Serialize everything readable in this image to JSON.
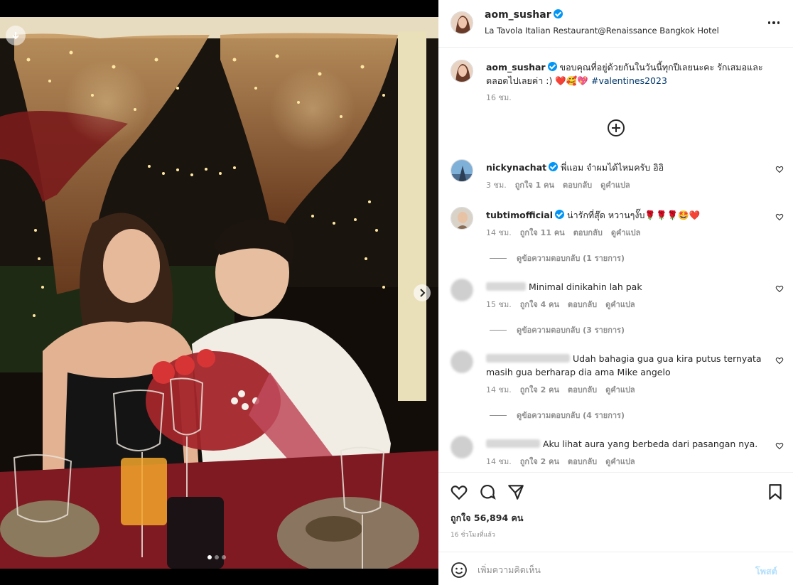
{
  "post": {
    "username": "aom_sushar",
    "location": "La Tavola Italian Restaurant@Renaissance Bangkok Hotel",
    "caption_text": "ขอบคุณที่อยู่ด้วยกันในวันนี้ทุกปีเลยนะคะ รักเสมอและตลอดไปเลยค่า :) ❤️🥰💖 ",
    "hashtag": "#valentines2023",
    "caption_time": "16 ชม.",
    "likes": "ถูกใจ 56,894 คน",
    "posted": "16 ชั่วโมงที่แล้ว",
    "media_dots": 3,
    "active_dot": 0
  },
  "comments": [
    {
      "username": "nickynachat",
      "verified": true,
      "text": "พี่แอม จำผมได้ไหมครับ อิอิ",
      "time": "3 ชม.",
      "likes": "ถูกใจ 1 คน",
      "reply": "ตอบกลับ",
      "translate": "ดูคำแปล",
      "replies": ""
    },
    {
      "username": "tubtimofficial",
      "verified": true,
      "text": "น่ารักที่สุ๊ด หวานๆงั๊บ🌹🌹🌹🤩❤️",
      "time": "14 ชม.",
      "likes": "ถูกใจ 11 คน",
      "reply": "ตอบกลับ",
      "translate": "ดูคำแปล",
      "replies": "ดูข้อความตอบกลับ (1 รายการ)"
    },
    {
      "username": "",
      "verified": false,
      "text": "Minimal dinikahin lah pak",
      "time": "15 ชม.",
      "likes": "ถูกใจ 4 คน",
      "reply": "ตอบกลับ",
      "translate": "ดูคำแปล",
      "replies": "ดูข้อความตอบกลับ (3 รายการ)"
    },
    {
      "username": "",
      "verified": false,
      "text": "Udah bahagia gua gua kira putus ternyata masih gua berharap dia ama Mike angelo",
      "time": "14 ชม.",
      "likes": "ถูกใจ 2 คน",
      "reply": "ตอบกลับ",
      "translate": "ดูคำแปล",
      "replies": "ดูข้อความตอบกลับ (4 รายการ)"
    },
    {
      "username": "",
      "verified": false,
      "text": "Aku lihat aura yang berbeda dari pasangan nya.",
      "time": "14 ชม.",
      "likes": "ถูกใจ 2 คน",
      "reply": "ตอบกลับ",
      "translate": "ดูคำแปล",
      "replies": ""
    }
  ],
  "composer": {
    "placeholder": "เพิ่มความคิดเห็น",
    "post_label": "โพสต์"
  },
  "icons": {
    "more": "more-horizontal-icon",
    "add": "plus-circle-icon",
    "like": "heart-icon",
    "comment": "comment-icon",
    "share": "send-icon",
    "save": "bookmark-icon",
    "emoji": "emoji-icon",
    "download": "download-icon",
    "next": "chevron-right-icon"
  },
  "colors": {
    "verified": "#0095f6",
    "hashtag": "#00376b",
    "secondary_text": "#8e8e8e",
    "post_button_disabled": "#b2dffc"
  }
}
